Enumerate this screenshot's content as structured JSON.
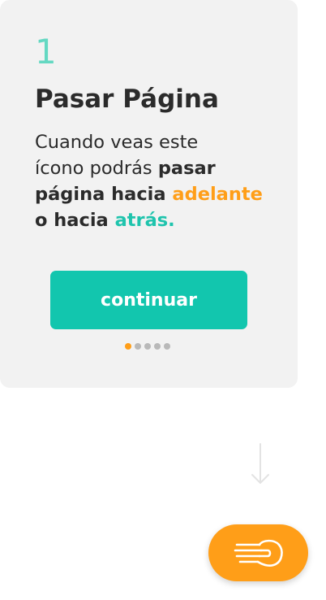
{
  "card": {
    "step_number": "1",
    "title": "Pasar Página",
    "description": {
      "line1": "Cuando veas este",
      "line2_regular": "ícono podrás ",
      "line2_bold": "pasar",
      "line3_bold": "página hacia ",
      "line3_orange": "adelante",
      "line4_bold": "o hacia ",
      "line4_teal": "atrás."
    },
    "continue_label": "continuar",
    "pagination": {
      "total": 5,
      "current": 1
    }
  },
  "fab": {
    "icon": "hand-swipe-icon"
  },
  "colors": {
    "accent_teal": "#12c6ae",
    "accent_orange": "#ff9e18",
    "card_bg": "#f2f2f2"
  }
}
